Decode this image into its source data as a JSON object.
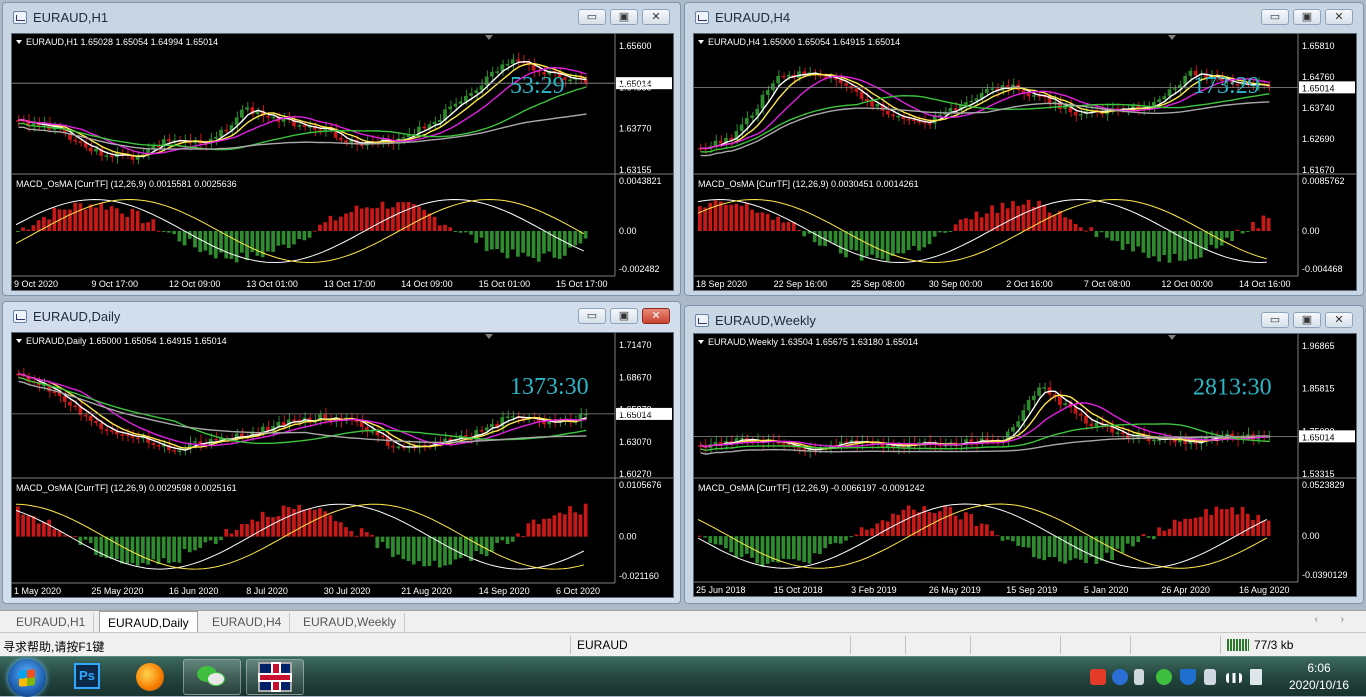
{
  "windows": [
    {
      "id": "h1",
      "title": "EURAUD,H1",
      "active": false,
      "info": "EURAUD,H1  1.65028 1.65054 1.64994 1.65014",
      "timer": "53:29",
      "price_labels": [
        "1.65600",
        "1.64385",
        "1.63770",
        "1.63155"
      ],
      "current_price": "1.65014",
      "macd_label": "MACD_OsMA [CurrTF] (12,26,9) 0.0015581 0.0025636",
      "macd_scale": [
        "0.0043821",
        "0.00",
        "-0.002482"
      ],
      "time_labels": [
        "9 Oct 2020",
        "9 Oct 17:00",
        "12 Oct 09:00",
        "13 Oct 01:00",
        "13 Oct 17:00",
        "14 Oct 09:00",
        "15 Oct 01:00",
        "15 Oct 17:00"
      ]
    },
    {
      "id": "h4",
      "title": "EURAUD,H4",
      "active": false,
      "info": "EURAUD,H4  1.65000 1.65054 1.64915 1.65014",
      "timer": "173:29",
      "price_labels": [
        "1.65810",
        "1.64760",
        "1.63740",
        "1.62690",
        "1.61670"
      ],
      "current_price": "1.65014",
      "macd_label": "MACD_OsMA [CurrTF] (12,26,9) 0.0030451 0.0014261",
      "macd_scale": [
        "0.0085762",
        "0.00",
        "-0.004468"
      ],
      "time_labels": [
        "18 Sep 2020",
        "22 Sep 16:00",
        "25 Sep 08:00",
        "30 Sep 00:00",
        "2 Oct 16:00",
        "7 Oct 08:00",
        "12 Oct 00:00",
        "14 Oct 16:00"
      ]
    },
    {
      "id": "d1",
      "title": "EURAUD,Daily",
      "active": true,
      "info": "EURAUD,Daily  1.65000 1.65054 1.64915 1.65014",
      "timer": "1373:30",
      "price_labels": [
        "1.71470",
        "1.68670",
        "1.65870",
        "1.63070",
        "1.60270"
      ],
      "current_price": "1.65014",
      "macd_label": "MACD_OsMA [CurrTF] (12,26,9) 0.0029598 0.0025161",
      "macd_scale": [
        "0.0105676",
        "0.00",
        "-0.021160"
      ],
      "time_labels": [
        "1 May 2020",
        "25 May 2020",
        "16 Jun 2020",
        "8 Jul 2020",
        "30 Jul 2020",
        "21 Aug 2020",
        "14 Sep 2020",
        "6 Oct 2020"
      ]
    },
    {
      "id": "w1",
      "title": "EURAUD,Weekly",
      "active": false,
      "info": "EURAUD,Weekly  1.63504 1.65675 1.63180 1.65014",
      "timer": "2813:30",
      "price_labels": [
        "1.96865",
        "1.85815",
        "1.75090",
        "1.53315"
      ],
      "current_price": "1.65014",
      "macd_label": "MACD_OsMA [CurrTF] (12,26,9) -0.0066197 -0.0091242",
      "macd_scale": [
        "0.0523829",
        "0.00",
        "-0.0390129"
      ],
      "time_labels": [
        "25 Jun 2018",
        "15 Oct 2018",
        "3 Feb 2019",
        "26 May 2019",
        "15 Sep 2019",
        "5 Jan 2020",
        "26 Apr 2020",
        "16 Aug 2020"
      ]
    }
  ],
  "win_buttons": {
    "minimize": "▭",
    "restore": "▣",
    "close": "✕"
  },
  "tabs": [
    "EURAUD,H1",
    "EURAUD,Daily",
    "EURAUD,H4",
    "EURAUD,Weekly"
  ],
  "active_tab": "EURAUD,Daily",
  "tab_arrows": "‹ ›",
  "status": {
    "help": "寻求帮助,请按F1键",
    "profile": "EURAUD",
    "connection": "77/3 kb"
  },
  "clock": {
    "time": "6:06",
    "date": "2020/10/16"
  },
  "colors": {
    "chart_bg": "#000000",
    "bull": "#2e8b2e",
    "bear": "#c81818",
    "ma_fast": "#ffffff",
    "ma_yellow": "#ffe84a",
    "ma_magenta": "#e020e0",
    "ma_green": "#3cc43c",
    "ma_gray": "#a8a8a8",
    "timer": "#2ab7c8"
  },
  "taskbar": [
    "start-orb",
    "photoshop-icon",
    "firefox-icon",
    "wechat-icon",
    "metatrader-icon"
  ]
}
